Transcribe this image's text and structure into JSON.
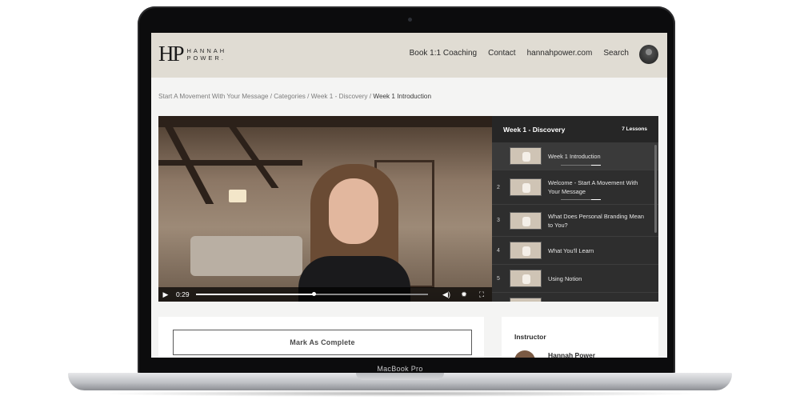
{
  "device": {
    "model_label": "MacBook Pro"
  },
  "site": {
    "logo_mark": "HP",
    "logo_line1": "HANNAH",
    "logo_line2": "POWER."
  },
  "nav": {
    "items": [
      "Book 1:1 Coaching",
      "Contact",
      "hannahpower.com",
      "Search"
    ]
  },
  "breadcrumb": {
    "parts": [
      "Start A Movement With Your Message",
      "Categories",
      "Week 1 - Discovery"
    ],
    "separator": " / ",
    "current": "Week 1 Introduction"
  },
  "video": {
    "current_time": "0:29",
    "progress_fraction": 0.51,
    "icons": {
      "play": "play-icon",
      "volume": "volume-icon",
      "settings": "settings-icon",
      "fullscreen": "fullscreen-icon"
    }
  },
  "playlist": {
    "title": "Week 1 - Discovery",
    "count": "7 Lessons",
    "lessons": [
      {
        "num": "",
        "label": "Week 1 Introduction"
      },
      {
        "num": "2",
        "label": "Welcome - Start A Movement With Your Message"
      },
      {
        "num": "3",
        "label": "What Does Personal Branding Mean to You?"
      },
      {
        "num": "4",
        "label": "What You'll Learn"
      },
      {
        "num": "5",
        "label": "Using Notion"
      },
      {
        "num": "6",
        "label": ""
      }
    ]
  },
  "actions": {
    "mark_complete": "Mark As Complete"
  },
  "instructor": {
    "heading": "Instructor",
    "name": "Hannah Power"
  },
  "colors": {
    "header_bg": "#e0dcd3",
    "playlist_bg": "#2e2e2e",
    "page_bg": "#f4f4f3"
  }
}
